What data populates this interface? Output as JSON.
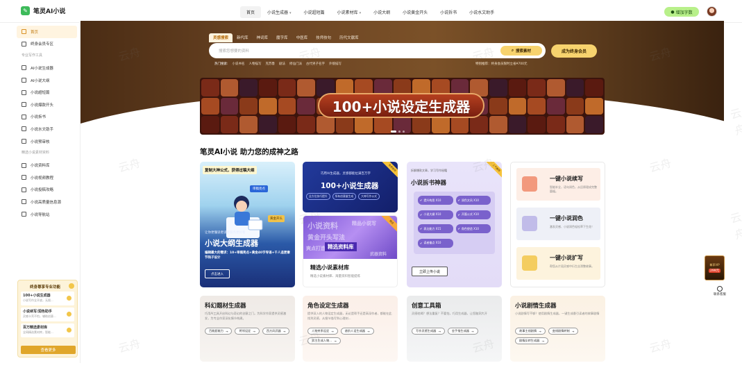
{
  "app": {
    "name": "笔灵AI小说"
  },
  "topnav": {
    "items": [
      {
        "label": "首页",
        "caret": false
      },
      {
        "label": "小说生成器",
        "caret": true
      },
      {
        "label": "小说超短篇",
        "caret": false
      },
      {
        "label": "小说素材库",
        "caret": true
      },
      {
        "label": "小说大纲",
        "caret": false
      },
      {
        "label": "小说黄金开头",
        "caret": false
      },
      {
        "label": "小说拆书",
        "caret": false
      },
      {
        "label": "小说水文助手",
        "caret": false
      }
    ],
    "words_button": "增加字数"
  },
  "sidebar": {
    "top_items": [
      "首页",
      "终身会员专区"
    ],
    "group1": "专业写作工具",
    "group1_items": [
      "AI小说生成器",
      "AI小说大纲",
      "小说超短篇",
      "小说爆款开头",
      "小说拆书",
      "小说水文助手",
      "小说预审核"
    ],
    "group2": "精选小说素材资料",
    "group2_items": [
      "小说资料库",
      "小说视频教程",
      "小说投稿攻略",
      "小说高质量信息源",
      "小说导航站"
    ],
    "promo": {
      "title": "终身尊享专业功能",
      "rows": [
        {
          "title": "100+小说生成器",
          "sub": "小说写作全开放，无限..."
        },
        {
          "title": "小说续写/润色助手",
          "sub": "灵感卡壳不怕，辅助创意..."
        },
        {
          "title": "百万精选素材库",
          "sub": "全网精选素材库，智能..."
        }
      ],
      "button": "查看更多"
    }
  },
  "hero": {
    "search_tabs": [
      "灵感搜索",
      "新代库",
      "神词库",
      "魔字库",
      "中医库",
      "技师技句",
      "历代文献库"
    ],
    "search_placeholder": "搜索您想要的资料",
    "search_button": "搜索素材",
    "member_button": "成为终身会员",
    "hot_label": "热门搜索:",
    "hot_terms": [
      "小说书名",
      "人物描写",
      "克苏鲁",
      "剧法",
      "修仙门派",
      "古代男子名字",
      "外貌描写"
    ],
    "recommend": "特别推荐：终身会员限时立省¥700元",
    "banner_title": "100+小说设定生成器"
  },
  "section": {
    "title": "笔灵AI小说 助力您的成神之路"
  },
  "cards": {
    "outline": {
      "tag": "复制大神公式，获得过稿大纲",
      "sticky1": "审稿亮点",
      "sticky2": "黄金开头",
      "sub": "让你更懂读者读者服务更好看",
      "title": "小说大纲生成器",
      "desc": "编辑最大的需求：10+审稿亮点+黄金40字导语+千人追更章节钩子设计",
      "button": "点击进入"
    },
    "gen100": {
      "sub": "巧用AI生成器，灵感都能拉满百万字",
      "title": "100+小说生成器",
      "tags": [
        "全方位技巧提升",
        "所有创意量生成",
        "大神写作公式"
      ],
      "corner": "免费使用"
    },
    "library": {
      "img_words": [
        "小说资料",
        "黄金开头写法",
        "爽点打造",
        "精品小说写",
        "武器资料"
      ],
      "label": "精选资料库",
      "title": "精选小说素材库",
      "desc": "精选小说素材库、海量资料智能提炼",
      "corner": "精选"
    },
    "split": {
      "sub": "拆解爆款文章，学习写作秘籍",
      "title": "小说拆书神器",
      "chips": [
        "提升构思 X10",
        "润色文风 X10",
        "小说大纲 X10",
        "开篇公式 X10",
        "表达能力 X15",
        "角色塑造 X10",
        "读者偏点 X10"
      ],
      "corner": "人气推荐",
      "button": "立即上传小说"
    },
    "mini": [
      {
        "title": "一键小说续写",
        "desc": "智能补全，语句润色，从旧原理成完整篇幅。"
      },
      {
        "title": "一键小说润色",
        "desc": "激发灵感、小说润色轻松草下生花！"
      },
      {
        "title": "一键小说扩写",
        "desc": "帮您从片段灵感中衍生丝滑整故事。"
      }
    ],
    "bottom": [
      {
        "title": "科幻题材生成器",
        "desc": "巧用AI工具开启科幻与奇幻的创意之门。为科学作家提供灵感激发，为专业作家深化情节构建。",
        "pills": [
          "百能超能力",
          "将领设定",
          "西方风武器"
        ]
      },
      {
        "title": "角色设定生成器",
        "desc": "提供深入的人物设定生成器，无论是帮手还是高深作者，都能在此找到灵感，从细节描写到心理刻...",
        "pills": [
          "人物关系设定",
          "谱阶人设生成器",
          "男主生成人物..."
        ]
      },
      {
        "title": "创意工具箱",
        "desc": "灵感枯竭？想法重复？不要怕，巧用生成器，让您脑洞大开",
        "pills": [
          "写作灵感生成器",
          "金手指生成器"
        ]
      },
      {
        "title": "小说剧情生成器",
        "desc": "小说剧情写不够？使用剧情生成器，一键生成悬引读者的故事剧情",
        "pills": [
          "故事主线剧情",
          "变线剧情转制",
          "剧情反转生成器"
        ]
      }
    ]
  },
  "right": {
    "vip": "尊享VIP",
    "vip_price": "299元",
    "cs": "联系客服"
  },
  "watermark": "云舟",
  "colors": {
    "brand": "#3dba5a",
    "accent": "#f7d36e",
    "hero_bg": "#6b4423"
  }
}
